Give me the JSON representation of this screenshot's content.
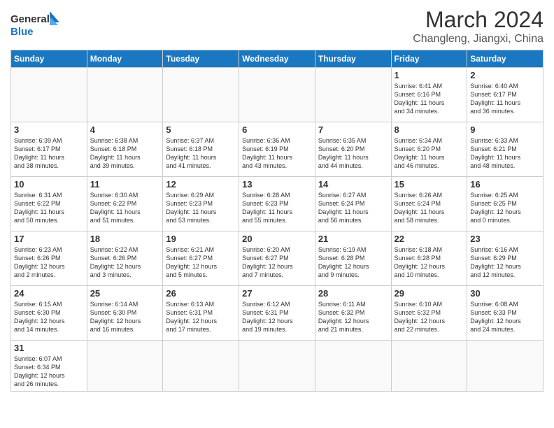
{
  "logo": {
    "text_general": "General",
    "text_blue": "Blue"
  },
  "title": "March 2024",
  "location": "Changleng, Jiangxi, China",
  "days_of_week": [
    "Sunday",
    "Monday",
    "Tuesday",
    "Wednesday",
    "Thursday",
    "Friday",
    "Saturday"
  ],
  "weeks": [
    [
      {
        "day": "",
        "info": ""
      },
      {
        "day": "",
        "info": ""
      },
      {
        "day": "",
        "info": ""
      },
      {
        "day": "",
        "info": ""
      },
      {
        "day": "",
        "info": ""
      },
      {
        "day": "1",
        "info": "Sunrise: 6:41 AM\nSunset: 6:16 PM\nDaylight: 11 hours\nand 34 minutes."
      },
      {
        "day": "2",
        "info": "Sunrise: 6:40 AM\nSunset: 6:17 PM\nDaylight: 11 hours\nand 36 minutes."
      }
    ],
    [
      {
        "day": "3",
        "info": "Sunrise: 6:39 AM\nSunset: 6:17 PM\nDaylight: 11 hours\nand 38 minutes."
      },
      {
        "day": "4",
        "info": "Sunrise: 6:38 AM\nSunset: 6:18 PM\nDaylight: 11 hours\nand 39 minutes."
      },
      {
        "day": "5",
        "info": "Sunrise: 6:37 AM\nSunset: 6:18 PM\nDaylight: 11 hours\nand 41 minutes."
      },
      {
        "day": "6",
        "info": "Sunrise: 6:36 AM\nSunset: 6:19 PM\nDaylight: 11 hours\nand 43 minutes."
      },
      {
        "day": "7",
        "info": "Sunrise: 6:35 AM\nSunset: 6:20 PM\nDaylight: 11 hours\nand 44 minutes."
      },
      {
        "day": "8",
        "info": "Sunrise: 6:34 AM\nSunset: 6:20 PM\nDaylight: 11 hours\nand 46 minutes."
      },
      {
        "day": "9",
        "info": "Sunrise: 6:33 AM\nSunset: 6:21 PM\nDaylight: 11 hours\nand 48 minutes."
      }
    ],
    [
      {
        "day": "10",
        "info": "Sunrise: 6:31 AM\nSunset: 6:22 PM\nDaylight: 11 hours\nand 50 minutes."
      },
      {
        "day": "11",
        "info": "Sunrise: 6:30 AM\nSunset: 6:22 PM\nDaylight: 11 hours\nand 51 minutes."
      },
      {
        "day": "12",
        "info": "Sunrise: 6:29 AM\nSunset: 6:23 PM\nDaylight: 11 hours\nand 53 minutes."
      },
      {
        "day": "13",
        "info": "Sunrise: 6:28 AM\nSunset: 6:23 PM\nDaylight: 11 hours\nand 55 minutes."
      },
      {
        "day": "14",
        "info": "Sunrise: 6:27 AM\nSunset: 6:24 PM\nDaylight: 11 hours\nand 56 minutes."
      },
      {
        "day": "15",
        "info": "Sunrise: 6:26 AM\nSunset: 6:24 PM\nDaylight: 11 hours\nand 58 minutes."
      },
      {
        "day": "16",
        "info": "Sunrise: 6:25 AM\nSunset: 6:25 PM\nDaylight: 12 hours\nand 0 minutes."
      }
    ],
    [
      {
        "day": "17",
        "info": "Sunrise: 6:23 AM\nSunset: 6:26 PM\nDaylight: 12 hours\nand 2 minutes."
      },
      {
        "day": "18",
        "info": "Sunrise: 6:22 AM\nSunset: 6:26 PM\nDaylight: 12 hours\nand 3 minutes."
      },
      {
        "day": "19",
        "info": "Sunrise: 6:21 AM\nSunset: 6:27 PM\nDaylight: 12 hours\nand 5 minutes."
      },
      {
        "day": "20",
        "info": "Sunrise: 6:20 AM\nSunset: 6:27 PM\nDaylight: 12 hours\nand 7 minutes."
      },
      {
        "day": "21",
        "info": "Sunrise: 6:19 AM\nSunset: 6:28 PM\nDaylight: 12 hours\nand 9 minutes."
      },
      {
        "day": "22",
        "info": "Sunrise: 6:18 AM\nSunset: 6:28 PM\nDaylight: 12 hours\nand 10 minutes."
      },
      {
        "day": "23",
        "info": "Sunrise: 6:16 AM\nSunset: 6:29 PM\nDaylight: 12 hours\nand 12 minutes."
      }
    ],
    [
      {
        "day": "24",
        "info": "Sunrise: 6:15 AM\nSunset: 6:30 PM\nDaylight: 12 hours\nand 14 minutes."
      },
      {
        "day": "25",
        "info": "Sunrise: 6:14 AM\nSunset: 6:30 PM\nDaylight: 12 hours\nand 16 minutes."
      },
      {
        "day": "26",
        "info": "Sunrise: 6:13 AM\nSunset: 6:31 PM\nDaylight: 12 hours\nand 17 minutes."
      },
      {
        "day": "27",
        "info": "Sunrise: 6:12 AM\nSunset: 6:31 PM\nDaylight: 12 hours\nand 19 minutes."
      },
      {
        "day": "28",
        "info": "Sunrise: 6:11 AM\nSunset: 6:32 PM\nDaylight: 12 hours\nand 21 minutes."
      },
      {
        "day": "29",
        "info": "Sunrise: 6:10 AM\nSunset: 6:32 PM\nDaylight: 12 hours\nand 22 minutes."
      },
      {
        "day": "30",
        "info": "Sunrise: 6:08 AM\nSunset: 6:33 PM\nDaylight: 12 hours\nand 24 minutes."
      }
    ],
    [
      {
        "day": "31",
        "info": "Sunrise: 6:07 AM\nSunset: 6:34 PM\nDaylight: 12 hours\nand 26 minutes."
      },
      {
        "day": "",
        "info": ""
      },
      {
        "day": "",
        "info": ""
      },
      {
        "day": "",
        "info": ""
      },
      {
        "day": "",
        "info": ""
      },
      {
        "day": "",
        "info": ""
      },
      {
        "day": "",
        "info": ""
      }
    ]
  ]
}
